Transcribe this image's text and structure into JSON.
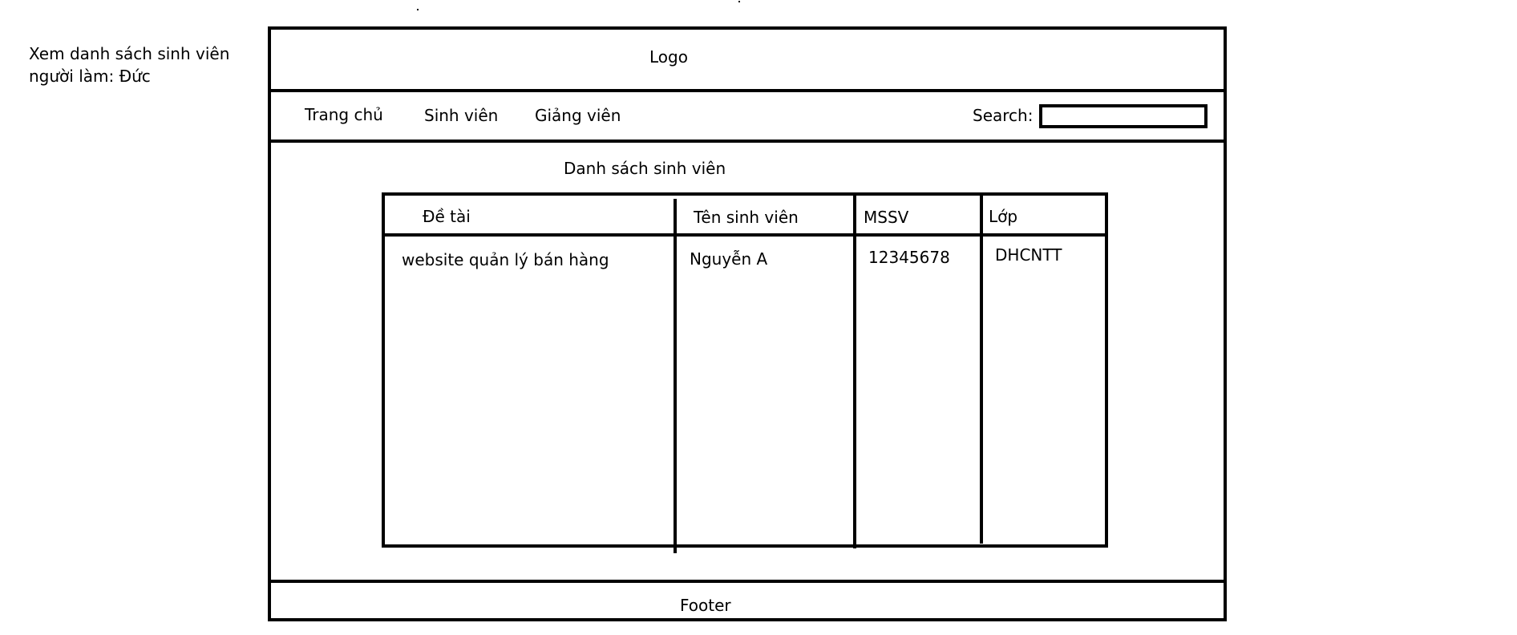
{
  "note": {
    "line1": "Xem danh sách sinh viên",
    "line2": "người làm: Đức"
  },
  "header": {
    "logo": "Logo"
  },
  "nav": {
    "items": [
      {
        "label": "Trang chủ"
      },
      {
        "label": "Sinh viên"
      },
      {
        "label": "Giảng viên"
      }
    ],
    "search_label": "Search:",
    "search_value": ""
  },
  "main": {
    "title": "Danh sách sinh viên",
    "table": {
      "columns": [
        "Đề tài",
        "Tên sinh viên",
        "MSSV",
        "Lớp"
      ],
      "rows": [
        [
          "website quản lý bán hàng",
          "Nguyễn A",
          "12345678",
          "DHCNTT"
        ]
      ]
    }
  },
  "footer": {
    "label": "Footer"
  }
}
